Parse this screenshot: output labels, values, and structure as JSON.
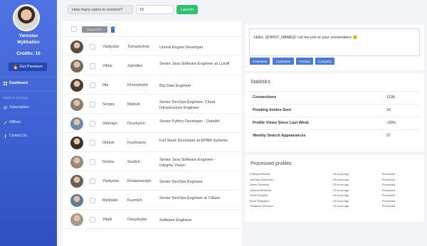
{
  "sidebar": {
    "user_first": "Yaroslav",
    "user_last": "Mykhailov",
    "credits": "Credits: 10",
    "premium_label": "Get Premium",
    "dashboard_label": "Dashboard",
    "section_label": "PROFILE SETTING",
    "subscription_label": "Subscription",
    "affiliate_label": "Affiliate",
    "contact_label": "Contact Us"
  },
  "topbar": {
    "question": "How many users to connect?",
    "count_value": "10",
    "launch_label": "Launch"
  },
  "table": {
    "export_label": "Export CSV",
    "rows": [
      {
        "first": "Vladyslav",
        "last": "Tomashchuk",
        "title": "Unreal Engine Developer",
        "avatar": "#5b4a3f"
      },
      {
        "first": "Viktor",
        "last": "Zahnitko",
        "title": "Senior Java Software Engineer at Luxoft",
        "avatar": "#7a6a5a"
      },
      {
        "first": "Illia",
        "last": "Khoroshykh",
        "title": "Big Data Engineer",
        "avatar": "#4a3b30"
      },
      {
        "first": "Sergey",
        "last": "Matsuk",
        "title": "Senior DevOps Engineer, Cloud Infrastructure Engineer",
        "avatar": "#8a7b6e"
      },
      {
        "first": "Valentyn",
        "last": "Druzhynin",
        "title": "Senior Python Developer - DataArt",
        "avatar": "#6f8aa8"
      },
      {
        "first": "Oleksii",
        "last": "Kushnarov",
        "title": "Full Stack Developer at EPAM Systems",
        "avatar": "#3d2f28"
      },
      {
        "first": "Grisha",
        "last": "Suslich",
        "title": "Senior Java Software Engineer - Integrity Vision",
        "avatar": "#9a8878"
      },
      {
        "first": "Vladyslav",
        "last": "Khalamendyk",
        "title": "Senior DevOps Engineer",
        "avatar": "#6b5d52"
      },
      {
        "first": "Mykhailo",
        "last": "Kuzmich",
        "title": "Senior DevOps Engineer at Ciklum",
        "avatar": "#5f7d96"
      },
      {
        "first": "Vitalii",
        "last": "Davyskyba",
        "title": "Software Engineer",
        "avatar": "#a89888"
      }
    ]
  },
  "message": {
    "text": "Hello, {{FIRST_NAME}}! Let me join to your connections 😉",
    "placeholders": [
      "FirstName",
      "LastName",
      "Position",
      "Company"
    ]
  },
  "statistics": {
    "title": "Statistics",
    "rows": [
      {
        "label": "Connections",
        "value": "1196"
      },
      {
        "label": "Pending Invites Sent",
        "value": "10"
      },
      {
        "label": "Profile Views Since Last Week",
        "value": "-20%"
      },
      {
        "label": "Weekly Search Appearances",
        "value": "37"
      }
    ]
  },
  "processed": {
    "title": "Processed profiles",
    "rows": [
      {
        "name": "Kateryna Bluzart",
        "time": "23 hours ago",
        "status": "Processed"
      },
      {
        "name": "Yaroslav Sydorenko",
        "time": "23 hours ago",
        "status": "Processed"
      },
      {
        "name": "Denis Chemeris",
        "time": "23 hours ago",
        "status": "Processed"
      },
      {
        "name": "Victoria Dikotchuk",
        "time": "23 hours ago",
        "status": "Processed"
      },
      {
        "name": "Serhii Danyliuk",
        "time": "23 hours ago",
        "status": "Processed"
      },
      {
        "name": "Boris Tatatyakov",
        "time": "23 hours ago",
        "status": "Processed"
      },
      {
        "name": "Vladyslav Blchenko",
        "time": "23 hours ago",
        "status": "Processed"
      }
    ]
  },
  "colors": {
    "sidebar_accent": "#3b5fd0",
    "launch": "#2fbf71",
    "placeholder_button": "#4a79d8"
  }
}
